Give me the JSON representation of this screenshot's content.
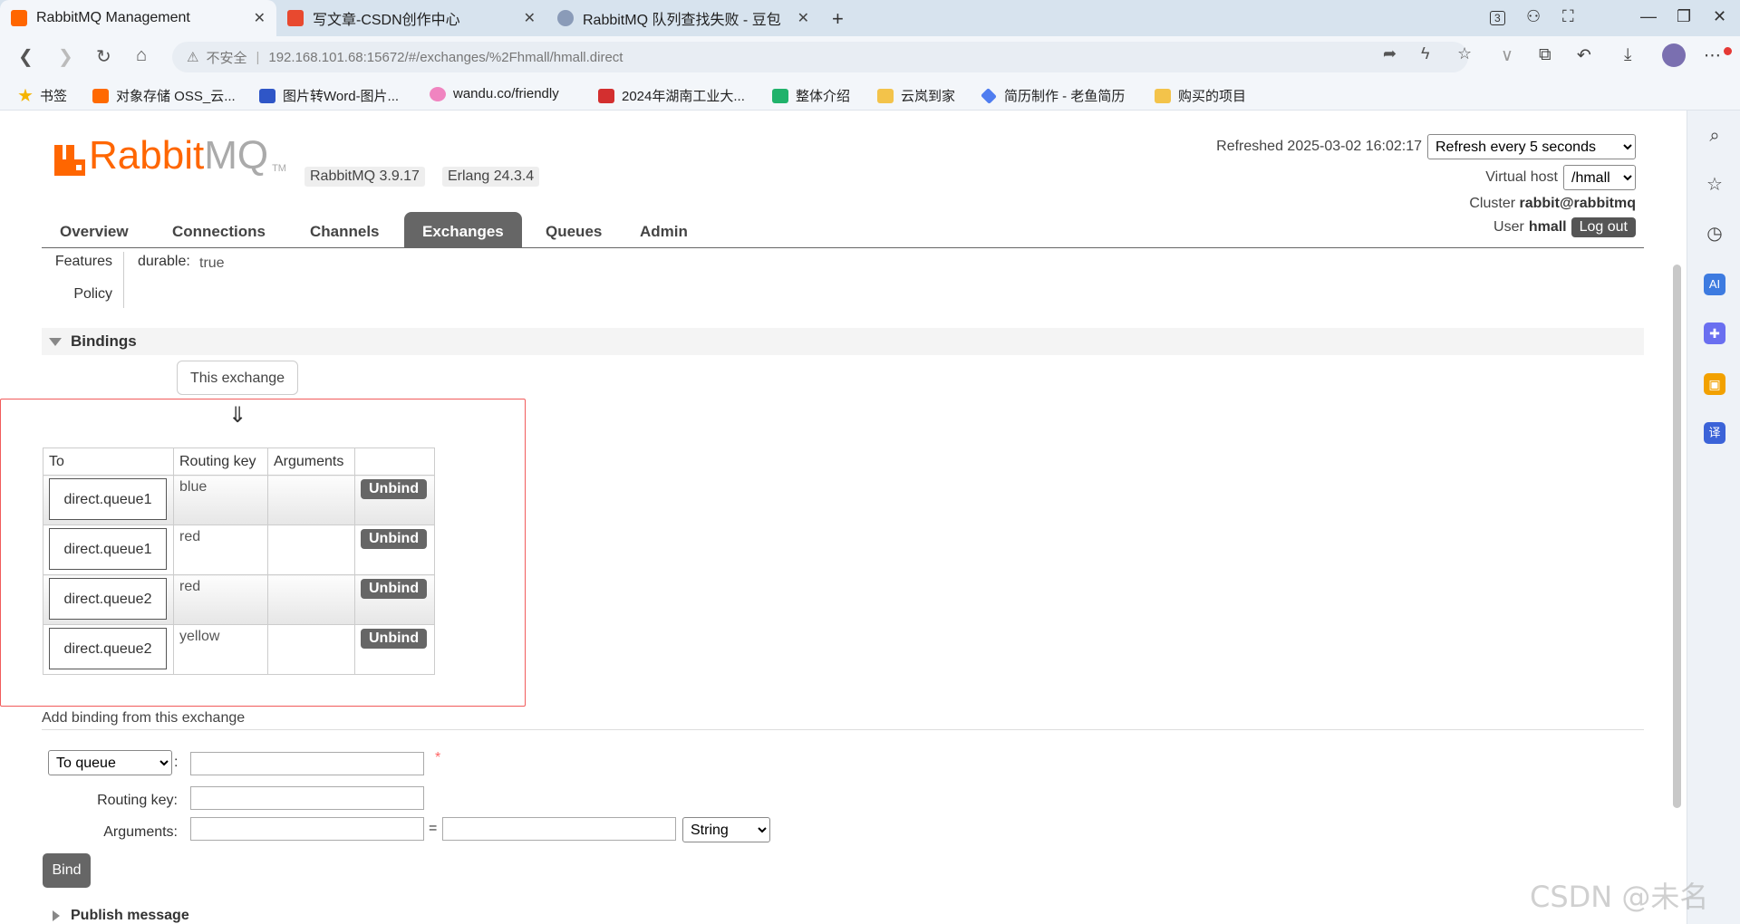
{
  "browser": {
    "tabs": [
      {
        "title": "RabbitMQ Management",
        "active": true
      },
      {
        "title": "写文章-CSDN创作中心",
        "active": false
      },
      {
        "title": "RabbitMQ 队列查找失败 - 豆包",
        "active": false
      }
    ],
    "new_tab": "+",
    "tab_close": "✕",
    "window_controls": {
      "tab_count": "3",
      "minimize": "—",
      "restore": "❐",
      "close": "✕"
    },
    "security": "不安全",
    "url": "192.168.101.68:15672/#/exchanges/%2Fhmall/hmall.direct",
    "bookmarks": [
      "书签",
      "对象存储 OSS_云...",
      "图片转Word-图片...",
      "wandu.co/friendly",
      "2024年湖南工业大...",
      "整体介绍",
      "云岚到家",
      "简历制作 - 老鱼简历",
      "购买的项目"
    ]
  },
  "header": {
    "logo_rabbit": "Rabbit",
    "logo_mq": "MQ",
    "logo_tm": "TM",
    "version": "RabbitMQ 3.9.17",
    "erlang": "Erlang 24.3.4",
    "refreshed": "Refreshed 2025-03-02 16:02:17",
    "refresh_select": "Refresh every 5 seconds",
    "virtual_host_label": "Virtual host",
    "virtual_host_value": "/hmall",
    "cluster_label": "Cluster",
    "cluster_value": "rabbit@rabbitmq",
    "user_label": "User",
    "user_value": "hmall",
    "logout_label": "Log out"
  },
  "nav": {
    "tabs": [
      "Overview",
      "Connections",
      "Channels",
      "Exchanges",
      "Queues",
      "Admin"
    ],
    "active": "Exchanges"
  },
  "details": {
    "features_label": "Features",
    "durable_key": "durable:",
    "durable_value": "true",
    "policy_label": "Policy"
  },
  "bindings": {
    "section_title": "Bindings",
    "this_exchange": "This exchange",
    "arrow": "⇓",
    "columns": [
      "To",
      "Routing key",
      "Arguments",
      ""
    ],
    "rows": [
      {
        "to": "direct.queue1",
        "routing_key": "blue",
        "arguments": "",
        "action": "Unbind"
      },
      {
        "to": "direct.queue1",
        "routing_key": "red",
        "arguments": "",
        "action": "Unbind"
      },
      {
        "to": "direct.queue2",
        "routing_key": "red",
        "arguments": "",
        "action": "Unbind"
      },
      {
        "to": "direct.queue2",
        "routing_key": "yellow",
        "arguments": "",
        "action": "Unbind"
      }
    ]
  },
  "add_binding": {
    "title": "Add binding from this exchange",
    "destination_select": "To queue",
    "colon": ":",
    "required_mark": "*",
    "routing_key_label": "Routing key:",
    "arguments_label": "Arguments:",
    "equals": "=",
    "type_select": "String",
    "bind_label": "Bind"
  },
  "publish": {
    "title": "Publish message"
  },
  "watermark": "CSDN @未名",
  "colors": {
    "accent": "#ff6600",
    "active_tab": "#666666",
    "highlight_border": "#f15b5b"
  }
}
